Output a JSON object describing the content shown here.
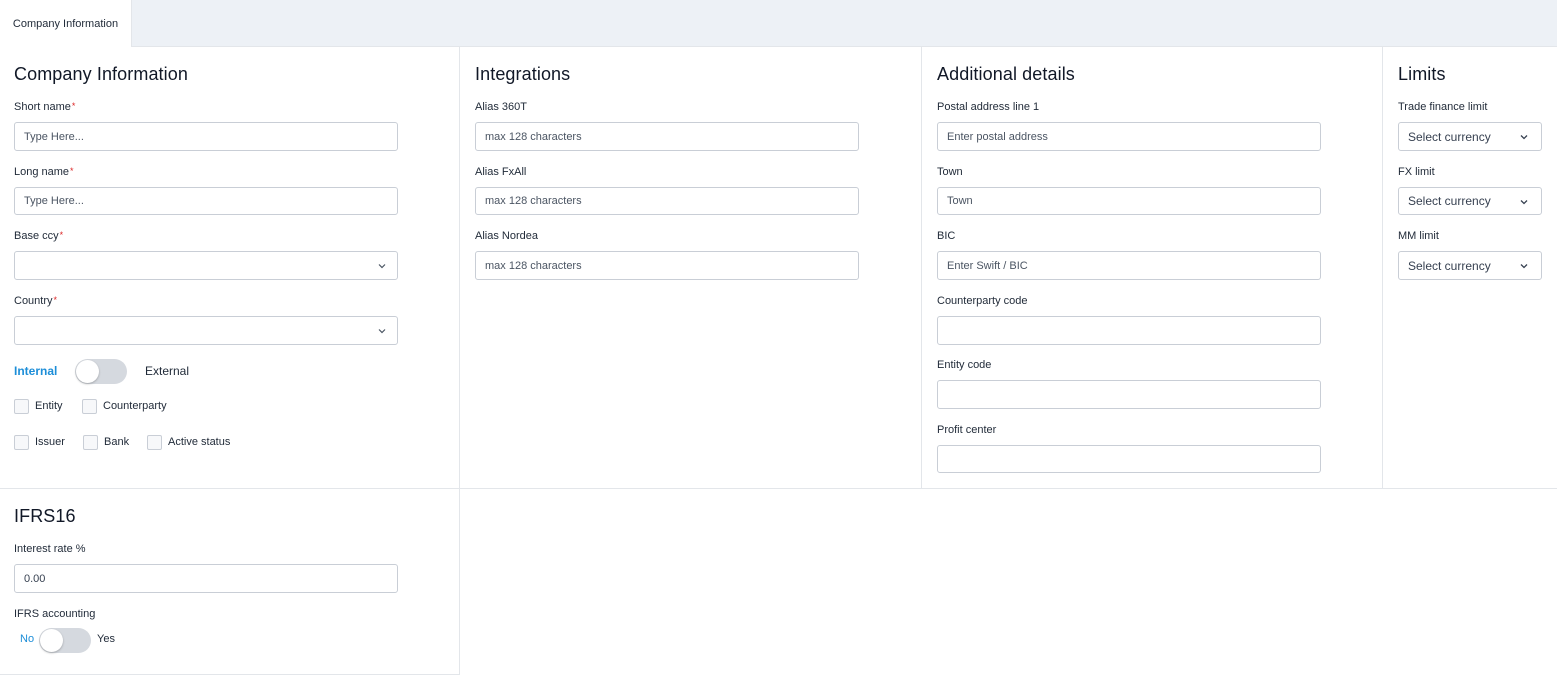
{
  "tabs": [
    {
      "label": "Company Information"
    }
  ],
  "company_info": {
    "title": "Company Information",
    "short_name": {
      "label": "Short name",
      "placeholder": "Type Here..."
    },
    "long_name": {
      "label": "Long name",
      "placeholder": "Type Here..."
    },
    "base_ccy": {
      "label": "Base ccy",
      "value": ""
    },
    "country": {
      "label": "Country",
      "value": ""
    },
    "required_mark": "*",
    "type_toggle": {
      "left_label": "Internal",
      "right_label": "External",
      "selected": "Internal"
    },
    "checkboxes": [
      {
        "label": "Entity",
        "checked": false
      },
      {
        "label": "Counterparty",
        "checked": false
      },
      {
        "label": "Issuer",
        "checked": false
      },
      {
        "label": "Bank",
        "checked": false
      },
      {
        "label": "Active status",
        "checked": false
      }
    ]
  },
  "integrations": {
    "title": "Integrations",
    "fields": [
      {
        "label": "Alias 360T",
        "placeholder": "max 128 characters"
      },
      {
        "label": "Alias FxAll",
        "placeholder": "max 128 characters"
      },
      {
        "label": "Alias Nordea",
        "placeholder": "max 128 characters"
      }
    ]
  },
  "additional_details": {
    "title": "Additional details",
    "fields": [
      {
        "label": "Postal address line 1",
        "placeholder": "Enter postal address"
      },
      {
        "label": "Town",
        "placeholder": "Town"
      },
      {
        "label": "BIC",
        "placeholder": "Enter Swift / BIC"
      },
      {
        "label": "Counterparty code",
        "placeholder": ""
      },
      {
        "label": "Entity code",
        "placeholder": ""
      },
      {
        "label": "Profit center",
        "placeholder": ""
      }
    ]
  },
  "limits": {
    "title": "Limits",
    "fields": [
      {
        "label": "Trade finance limit",
        "value": "Select currency"
      },
      {
        "label": "FX limit",
        "value": "Select currency"
      },
      {
        "label": "MM limit",
        "value": "Select currency"
      }
    ]
  },
  "ifrs16": {
    "title": "IFRS16",
    "interest_rate": {
      "label": "Interest rate %",
      "value": "0.00"
    },
    "ifrs_accounting": {
      "label": "IFRS accounting",
      "left_label": "No",
      "right_label": "Yes",
      "selected": "No"
    }
  },
  "colors": {
    "accent": "#1d8ed8",
    "required": "#dc2626",
    "tabbar_bg": "#edf1f6"
  },
  "icons": {
    "dropdown": "chevron-down-icon"
  }
}
